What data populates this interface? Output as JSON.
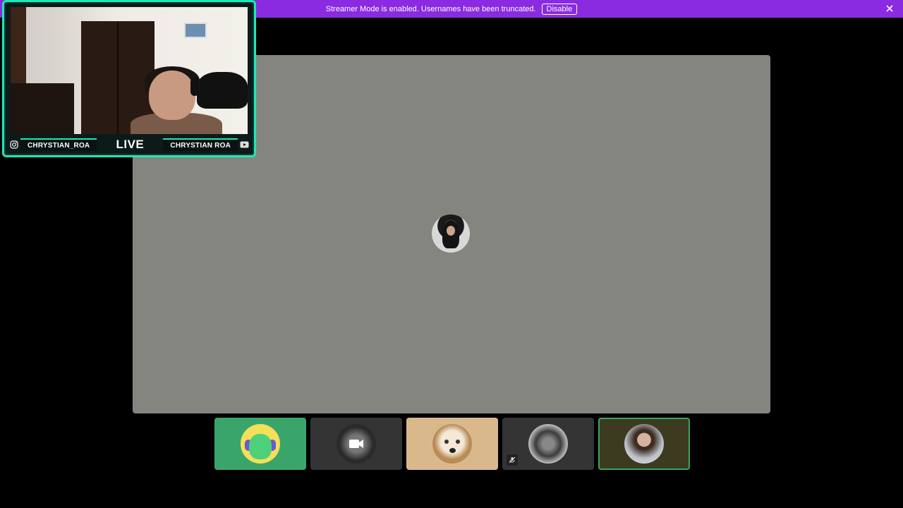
{
  "banner": {
    "message": "Streamer Mode is enabled. Usernames have been truncated.",
    "disable_label": "Disable",
    "color": "#8a2be2"
  },
  "webcam": {
    "instagram_handle": "CHRYSTIAN_ROA",
    "live_label": "LIVE",
    "youtube_handle": "CHRYSTIAN ROA",
    "frame_color": "#1de9b6"
  },
  "stage": {
    "background": "#858580"
  },
  "tiles": [
    {
      "kind": "avatar-bot",
      "background": "#3aa56b"
    },
    {
      "kind": "camera-off",
      "background": "#343434"
    },
    {
      "kind": "avatar-dog",
      "background": "#d9b98c"
    },
    {
      "kind": "avatar-muted",
      "background": "#343434",
      "muted": true
    },
    {
      "kind": "avatar-speaking",
      "background": "#3c3a1f",
      "speaking": true
    }
  ],
  "icons": [
    "close-icon",
    "instagram-icon",
    "youtube-icon",
    "camera-icon",
    "mic-muted-icon"
  ]
}
